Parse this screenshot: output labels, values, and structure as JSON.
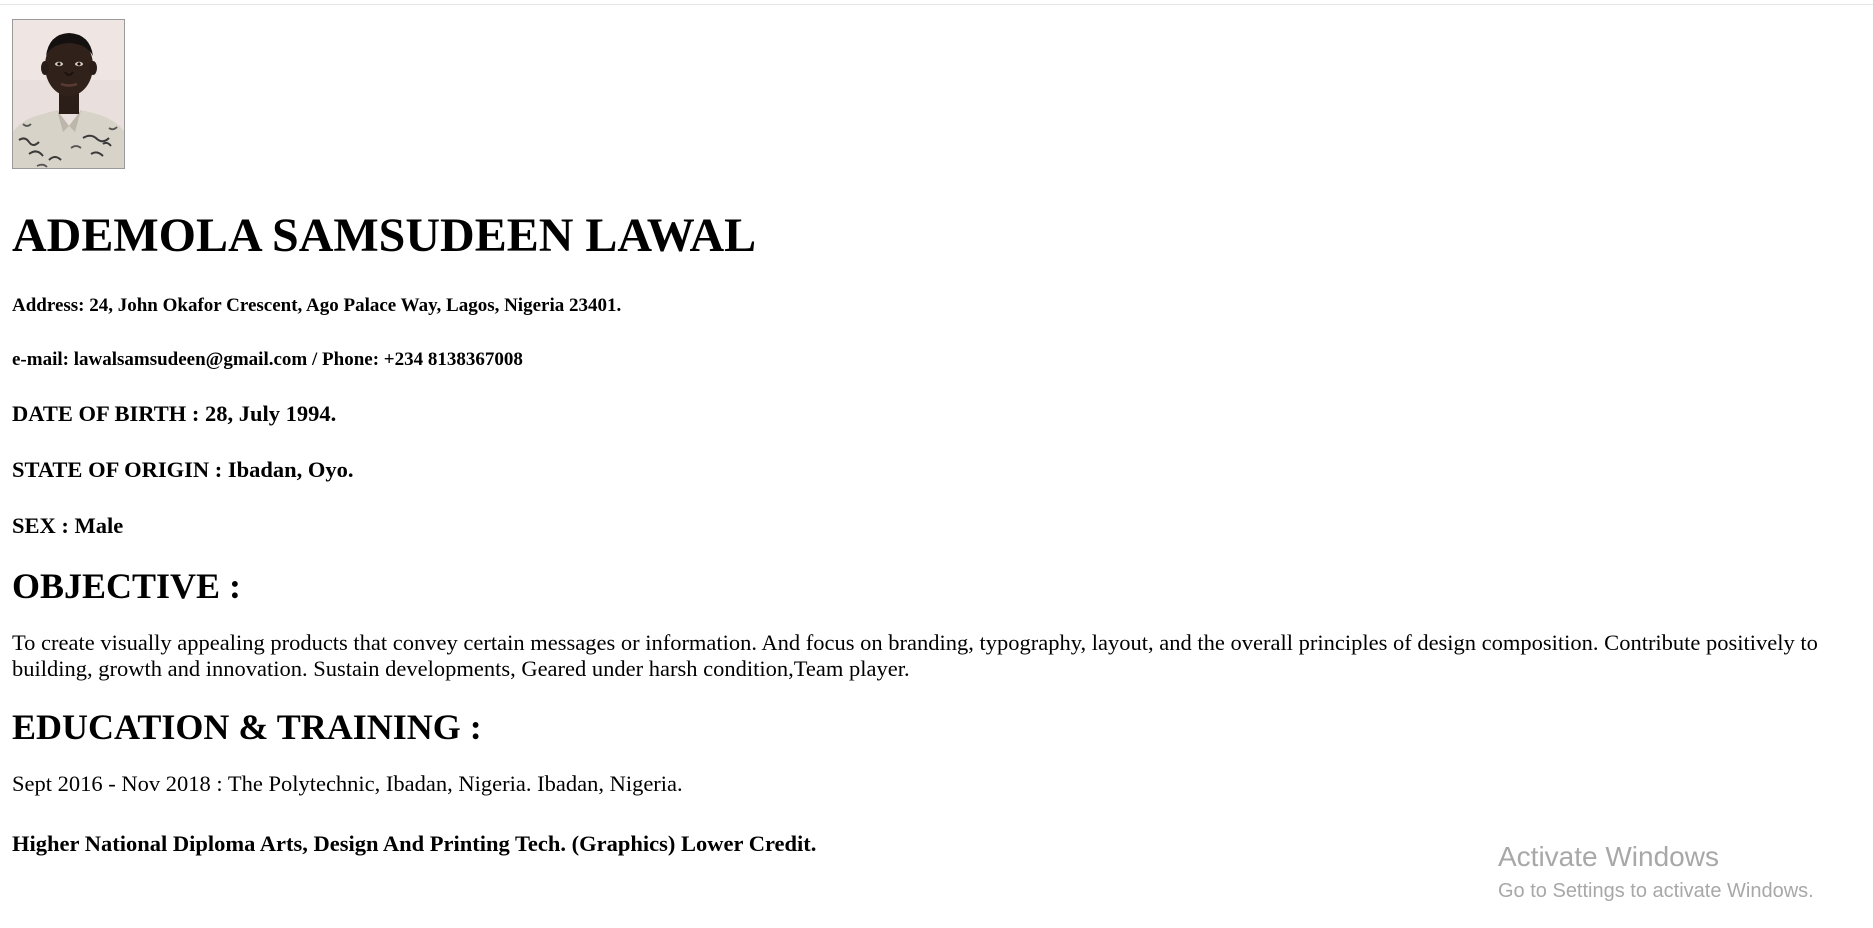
{
  "resume": {
    "photo_alt": "profile-photo",
    "name": "ADEMOLA SAMSUDEEN LAWAL",
    "address": "Address: 24, John Okafor Crescent, Ago Palace Way, Lagos, Nigeria 23401.",
    "contact": "e-mail: lawalsamsudeen@gmail.com / Phone: +234 8138367008",
    "date_of_birth": "DATE OF BIRTH : 28, July 1994.",
    "state_of_origin": "STATE OF ORIGIN : Ibadan, Oyo.",
    "sex": "SEX : Male",
    "objective": {
      "heading": "OBJECTIVE :",
      "text": "To create visually appealing products that convey certain messages or information. And focus on branding, typography, layout, and the overall principles of design composition. Contribute positively to building, growth and innovation. Sustain developments, Geared under harsh condition,Team player."
    },
    "education": {
      "heading": "EDUCATION & TRAINING :",
      "entry_dates": "Sept 2016 - Nov 2018 : The Polytechnic, Ibadan, Nigeria. Ibadan, Nigeria.",
      "entry_qualification": "Higher National Diploma Arts, Design And Printing Tech. (Graphics) Lower Credit."
    }
  },
  "windows_watermark": {
    "title": "Activate Windows",
    "subtitle": "Go to Settings to activate Windows."
  }
}
